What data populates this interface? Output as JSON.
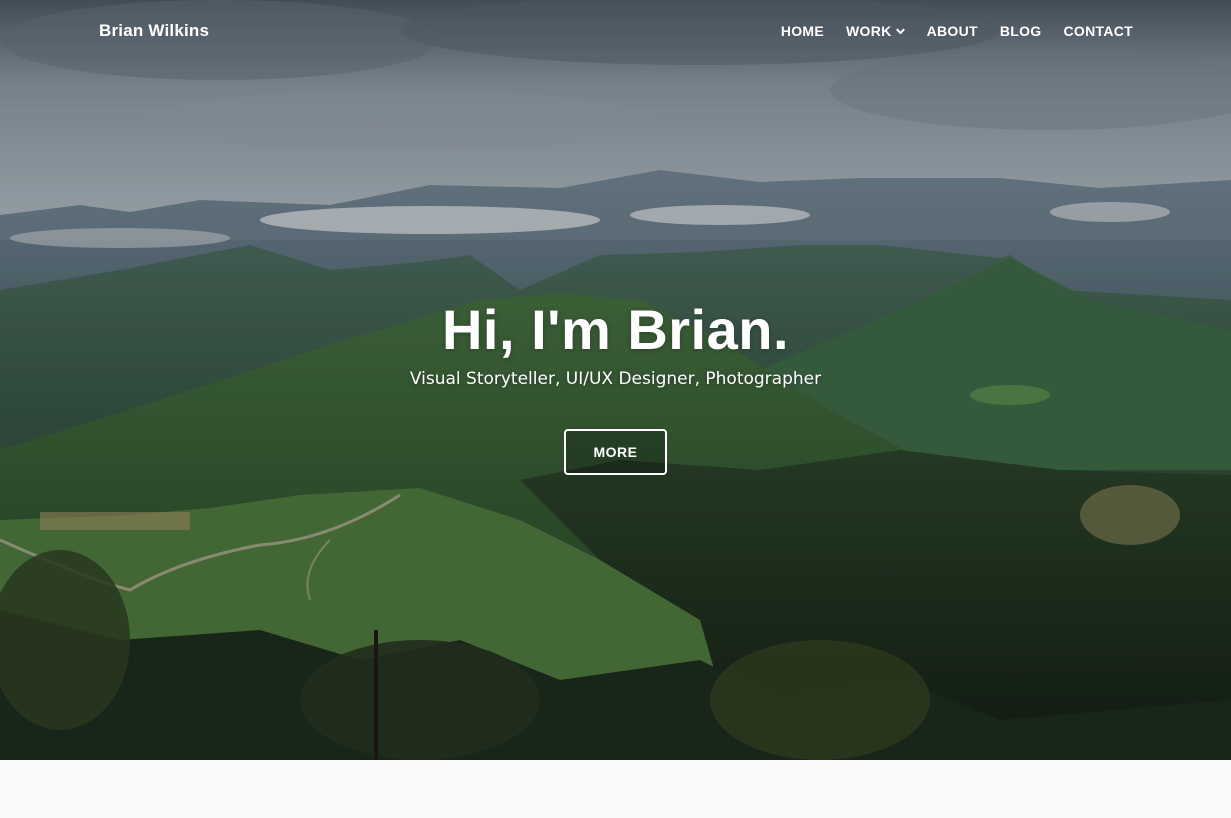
{
  "site": {
    "brand": "Brian Wilkins"
  },
  "nav": {
    "items": [
      {
        "label": "HOME"
      },
      {
        "label": "WORK",
        "has_dropdown": true
      },
      {
        "label": "ABOUT"
      },
      {
        "label": "BLOG"
      },
      {
        "label": "CONTACT"
      }
    ]
  },
  "hero": {
    "title": "Hi, I'm Brian.",
    "subtitle": "Visual Storyteller, UI/UX Designer, Photographer",
    "button_label": "MORE",
    "background": "mountain-landscape-photo"
  },
  "colors": {
    "text": "#ffffff",
    "page_background": "#fafafa"
  }
}
